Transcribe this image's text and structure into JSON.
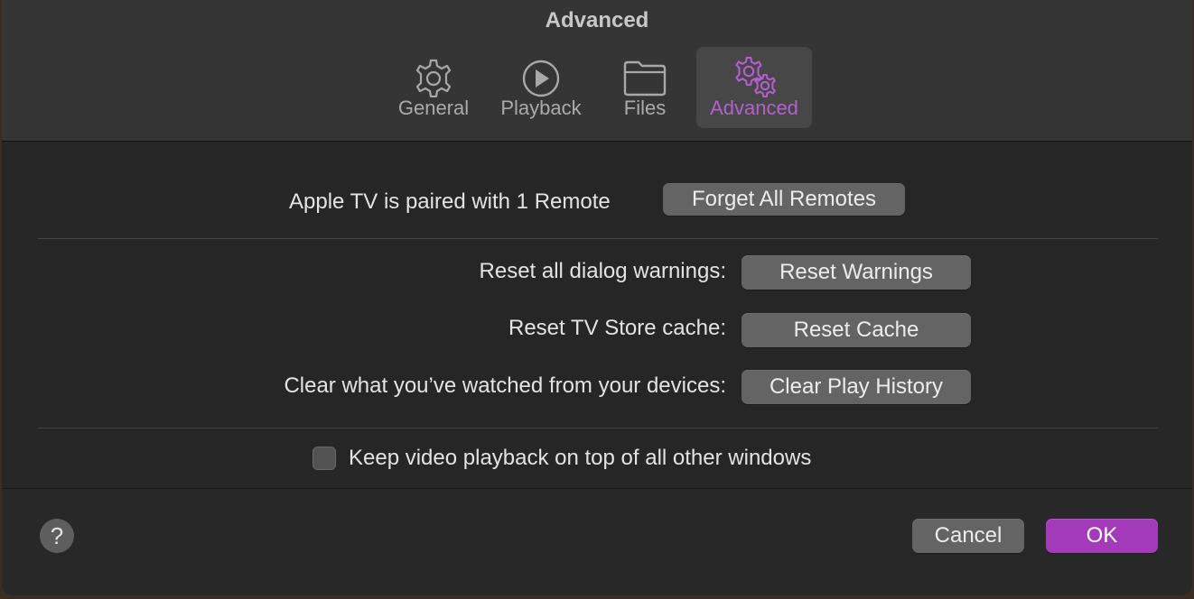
{
  "window": {
    "title": "Advanced"
  },
  "tabs": [
    {
      "label": "General",
      "icon": "gear-icon",
      "selected": false
    },
    {
      "label": "Playback",
      "icon": "play-circle-icon",
      "selected": false
    },
    {
      "label": "Files",
      "icon": "folder-icon",
      "selected": false
    },
    {
      "label": "Advanced",
      "icon": "gears-icon",
      "selected": true
    }
  ],
  "remotes": {
    "label": "Apple TV is paired with 1 Remote",
    "button": "Forget All Remotes"
  },
  "resets": [
    {
      "label": "Reset all dialog warnings:",
      "button": "Reset Warnings"
    },
    {
      "label": "Reset TV Store cache:",
      "button": "Reset Cache"
    },
    {
      "label": "Clear what you’ve watched from your devices:",
      "button": "Clear Play History"
    }
  ],
  "keep_on_top": {
    "label": "Keep video playback on top of all other windows",
    "checked": false
  },
  "footer": {
    "help": "?",
    "cancel": "Cancel",
    "ok": "OK"
  },
  "colors": {
    "accent": "#a33ab9",
    "selected_tab_text": "#b35fd0"
  }
}
